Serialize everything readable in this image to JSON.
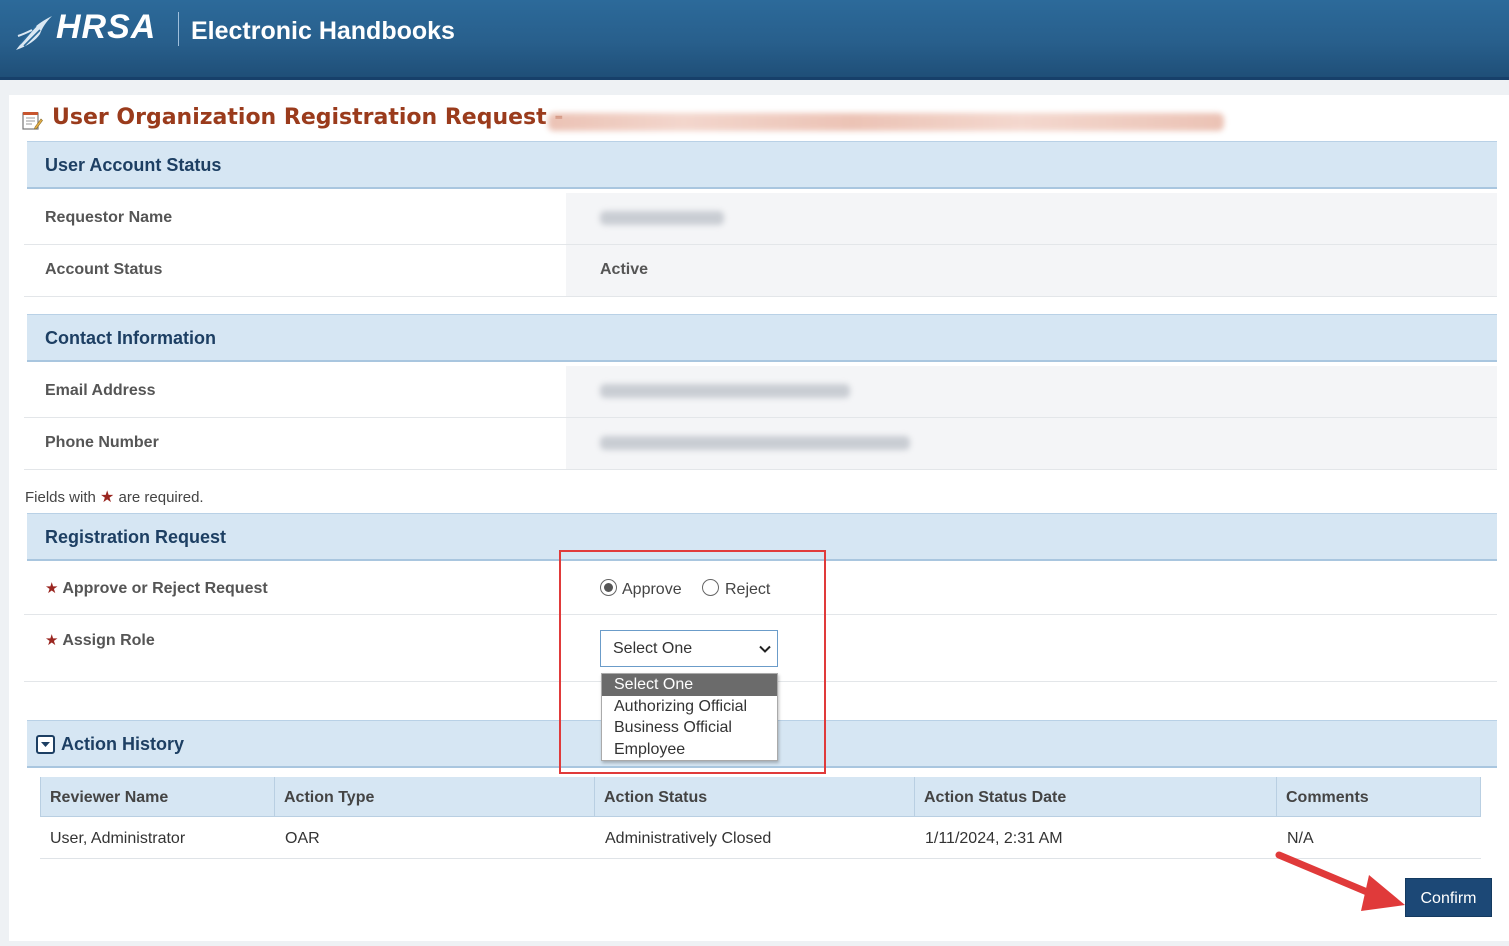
{
  "header": {
    "logo_text": "HRSA",
    "app_name": "Electronic Handbooks"
  },
  "page": {
    "title": "User Organization Registration Request -"
  },
  "user_account_status": {
    "heading": "User Account Status",
    "requestor_name_label": "Requestor Name",
    "account_status_label": "Account Status",
    "account_status_value": "Active"
  },
  "contact_information": {
    "heading": "Contact Information",
    "email_label": "Email Address",
    "phone_label": "Phone Number"
  },
  "required_note": {
    "prefix": "Fields with",
    "suffix": "are required."
  },
  "registration_request": {
    "heading": "Registration Request",
    "approve_reject_label": "Approve or Reject Request",
    "approve_label": "Approve",
    "reject_label": "Reject",
    "selected_decision": "Approve",
    "assign_role_label": "Assign Role",
    "role_select_value": "Select One",
    "role_options": [
      "Select One",
      "Authorizing Official",
      "Business Official",
      "Employee"
    ]
  },
  "action_history": {
    "heading": "Action History",
    "columns": [
      "Reviewer Name",
      "Action Type",
      "Action Status",
      "Action Status Date",
      "Comments"
    ],
    "rows": [
      [
        "User, Administrator",
        "OAR",
        "Administratively Closed",
        "1/11/2024, 2:31 AM",
        "N/A"
      ]
    ]
  },
  "actions": {
    "confirm_label": "Confirm"
  },
  "colors": {
    "banner": "#285f8c",
    "title": "#9a3b1c",
    "section_header_bg": "#d6e6f3",
    "confirm_button": "#1c4876",
    "annotation_red": "#e03a3a"
  }
}
